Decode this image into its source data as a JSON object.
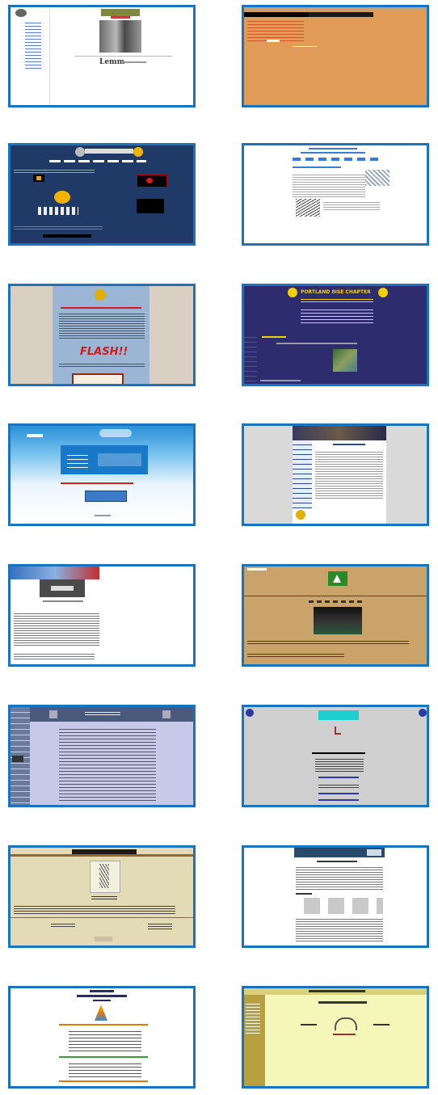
{
  "thumbnails": [
    {
      "id": "t1",
      "bg": "#ffffff",
      "title_lettering": "Lemm",
      "accent": "#8a8a3a"
    },
    {
      "id": "t2",
      "bg": "#e29a57",
      "accent": "#000000"
    },
    {
      "id": "t3",
      "bg": "#1f3a66",
      "accent": "#f0b400"
    },
    {
      "id": "t4",
      "bg": "#ffffff",
      "accent": "#3b7cd0"
    },
    {
      "id": "t5",
      "bg": "#9ab6d4",
      "flash": "FLASH!!",
      "accent": "#d11a1a"
    },
    {
      "id": "t6",
      "bg": "#2c2c6e",
      "heading": "PORTLAND 8ISE CHAPTER",
      "accent": "#f0d000"
    },
    {
      "id": "t7",
      "bg": "#3aa0e0",
      "accent": "#1a78c8"
    },
    {
      "id": "t8",
      "bg": "#d9d9d9",
      "accent": "#2a4a8a"
    },
    {
      "id": "t9",
      "bg": "#ffffff",
      "accent": "#c03030"
    },
    {
      "id": "t10",
      "bg": "#c9a36a",
      "accent": "#2a8a2a"
    },
    {
      "id": "t11",
      "bg": "#c8c8e8",
      "accent": "#4a5a7a"
    },
    {
      "id": "t12",
      "bg": "#cfcfcf",
      "accent": "#1fcfd0"
    },
    {
      "id": "t13",
      "bg": "#e3dbb5",
      "accent": "#1a1a1a"
    },
    {
      "id": "t14",
      "bg": "#ffffff",
      "accent": "#2a4a6a"
    },
    {
      "id": "t15",
      "bg": "#ffffff",
      "accent": "#e07a10"
    },
    {
      "id": "t16",
      "bg": "#f4f7b8",
      "accent": "#b8a040"
    }
  ]
}
